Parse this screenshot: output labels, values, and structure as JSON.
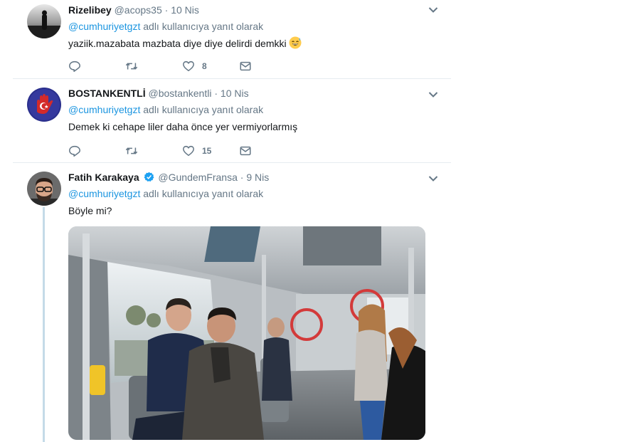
{
  "tweets": [
    {
      "name": "Rizelibey",
      "handle": "@acops35",
      "separator": "·",
      "time": "10 Nis",
      "reply_prefix": "@cumhuriyetgzt",
      "reply_suffix": " adlı kullanıcıya yanıt olarak",
      "text": "yaziik.mazabata mazbata diye diye delirdi demkki",
      "emoji": "sweat-smile-emoji",
      "likes": "8"
    },
    {
      "name": "BOSTANKENTLİ",
      "handle": "@bostankentli",
      "separator": "·",
      "time": "10 Nis",
      "reply_prefix": "@cumhuriyetgzt",
      "reply_suffix": " adlı kullanıcıya yanıt olarak",
      "text": "Demek ki cehape liler daha önce yer vermiyorlarmış",
      "likes": "15"
    },
    {
      "name": "Fatih Karakaya",
      "handle": "@GundemFransa",
      "separator": "·",
      "time": "9 Nis",
      "reply_prefix": "@cumhuriyetgzt",
      "reply_suffix": " adlı kullanıcıya yanıt olarak",
      "text": "Böyle mi?",
      "verified": true
    }
  ],
  "icons": [
    "reply-icon",
    "retweet-icon",
    "like-icon",
    "direct-message-icon",
    "chevron-down-icon",
    "verified-badge-icon"
  ],
  "colors": {
    "link": "#1b95e0",
    "meta": "#657786",
    "divider": "#e6ecf0",
    "thread_line": "#c4dbe8",
    "verified": "#1da1f2"
  }
}
